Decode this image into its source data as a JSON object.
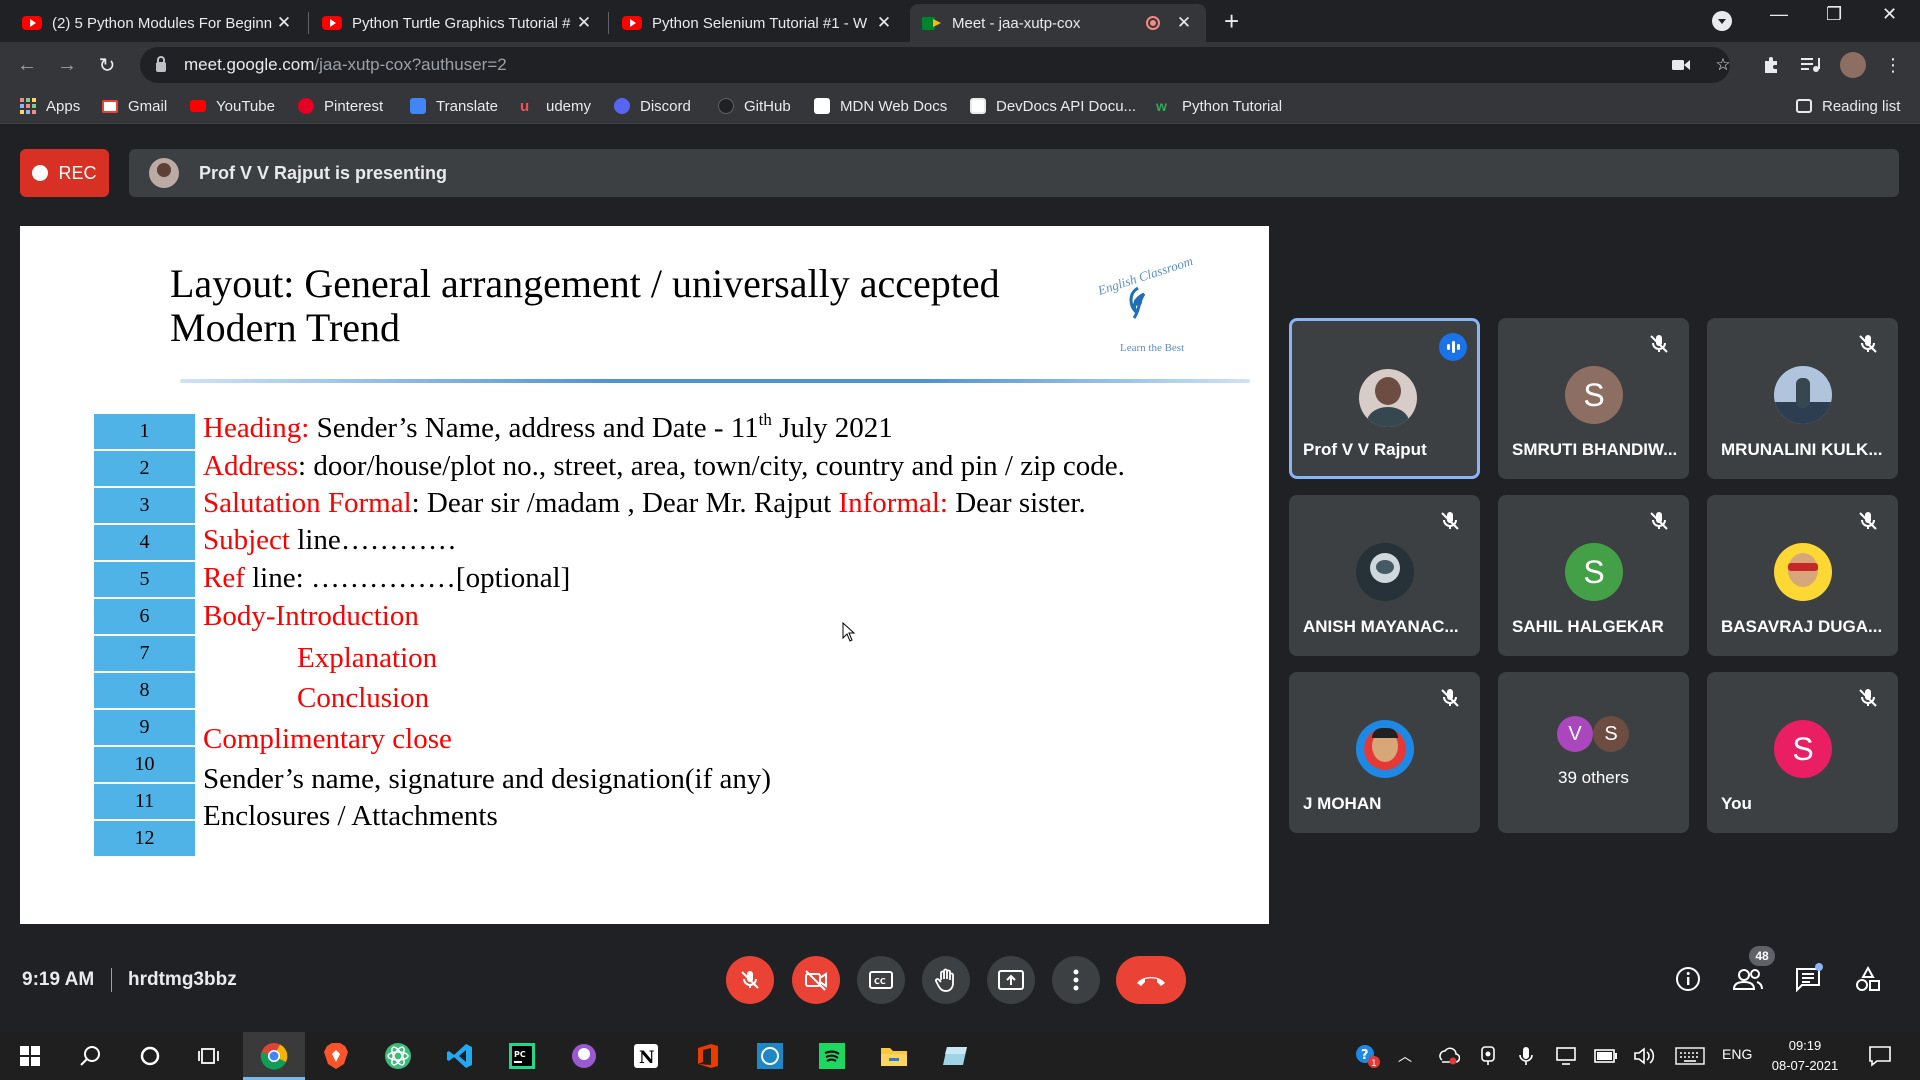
{
  "browser": {
    "tabs": [
      {
        "title": "(2) 5 Python Modules For Beginn",
        "favicon": "youtube-icon"
      },
      {
        "title": "Python Turtle Graphics Tutorial #",
        "favicon": "youtube-icon"
      },
      {
        "title": "Python Selenium Tutorial #1 - W",
        "favicon": "youtube-icon"
      },
      {
        "title": "Meet - jaa-xutp-cox",
        "favicon": "google-meet-icon",
        "active": true
      }
    ],
    "url_host": "meet.google.com",
    "url_path": "/jaa-xutp-cox?authuser=2",
    "bookmarks": [
      "Apps",
      "Gmail",
      "YouTube",
      "Pinterest",
      "Translate",
      "udemy",
      "Discord",
      "GitHub",
      "MDN Web Docs",
      "DevDocs API Docu...",
      "Python Tutorial"
    ],
    "reading_list": "Reading list"
  },
  "meet": {
    "rec_label": "REC",
    "presenting_text": "Prof V V Rajput is presenting",
    "time": "9:19 AM",
    "meeting_code": "hrdtmg3bbz",
    "participant_count": "48",
    "participants": [
      {
        "name": "Prof V V Rajput",
        "speaking": true
      },
      {
        "name": "SMRUTI BHANDIW...",
        "initial": "S",
        "color": "#8d6e63"
      },
      {
        "name": "MRUNALINI KULK..."
      },
      {
        "name": "ANISH MAYANAC..."
      },
      {
        "name": "SAHIL HALGEKAR",
        "initial": "S",
        "color": "#43a047"
      },
      {
        "name": "BASAVRAJ DUGA..."
      },
      {
        "name": "J MOHAN"
      },
      {
        "name": "39 others",
        "initials": [
          "V",
          "S"
        ]
      },
      {
        "name": "You",
        "initial": "S",
        "color": "#e91e63"
      }
    ]
  },
  "slide": {
    "title_line1": "Layout: General arrangement / universally accepted",
    "title_line2": "Modern Trend",
    "logo_text": "English Classroom",
    "logo_sub": "Learn the Best",
    "numbers": [
      "1",
      "2",
      "3",
      "4",
      "5",
      "6",
      "7",
      "8",
      "9",
      "10",
      "11",
      "12"
    ],
    "rows": {
      "r1_label": "Heading:",
      "r1_text": " Sender’s Name, address and Date  - 11",
      "r1_sup": "th",
      "r1_tail": " July 2021",
      "r2_label": "Address",
      "r2_text": ": door/house/plot no., street, area, town/city, country and pin / zip code.",
      "r3_label": "Salutation Formal",
      "r3_text": ": Dear sir /madam , Dear Mr. Rajput ",
      "r3_label2": "Informal:",
      "r3_tail": " Dear sister.",
      "r4_label": "Subject",
      "r4_text": " line…………",
      "r5_label": "Ref",
      "r5_text": "  line: ……………[optional]",
      "r6_label": "Body-Introduction",
      "r7_label": "Explanation",
      "r8_label": "Conclusion",
      "r9_label": "Complimentary close",
      "r10_text": "Sender’s name, signature and designation(if any)",
      "r11_text": "Enclosures / Attachments"
    }
  },
  "taskbar": {
    "lang": "ENG",
    "time": "09:19",
    "date": "08-07-2021"
  }
}
